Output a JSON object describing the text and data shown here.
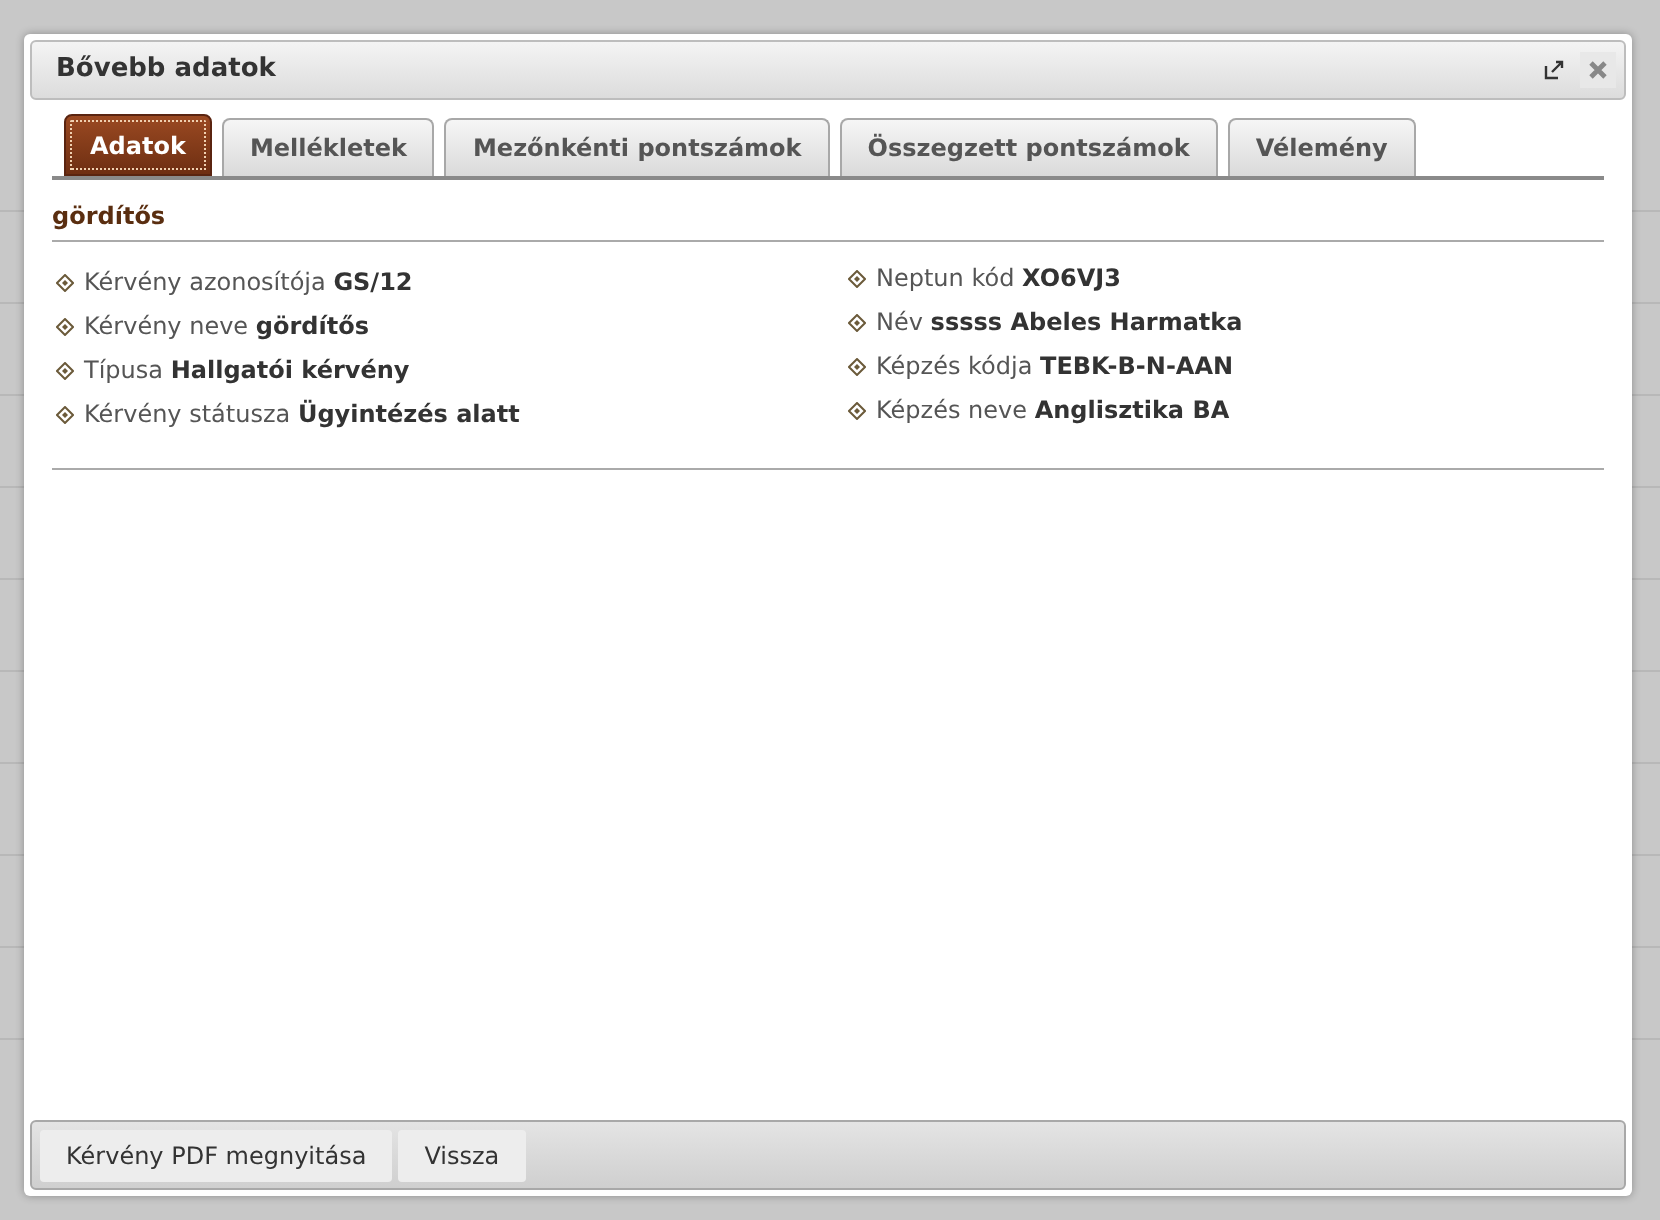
{
  "dialog": {
    "title": "Bővebb adatok"
  },
  "tabs": [
    {
      "label": "Adatok",
      "selected": true
    },
    {
      "label": "Mellékletek",
      "selected": false
    },
    {
      "label": "Mezőnkénti pontszámok",
      "selected": false
    },
    {
      "label": "Összegzett pontszámok",
      "selected": false
    },
    {
      "label": "Vélemény",
      "selected": false
    }
  ],
  "section_title": "gördítős",
  "columns": [
    [
      {
        "label": "Kérvény azonosítója",
        "value": "GS/12"
      },
      {
        "label": "Kérvény neve",
        "value": "gördítős"
      },
      {
        "label": "Típusa",
        "value": "Hallgatói kérvény"
      },
      {
        "label": "Kérvény státusza",
        "value": "Ügyintézés alatt"
      }
    ],
    [
      {
        "label": "Neptun kód",
        "value": "XO6VJ3"
      },
      {
        "label": "Név",
        "value": "sssss Abeles Harmatka"
      },
      {
        "label": "Képzés kódja",
        "value": "TEBK-B-N-AAN"
      },
      {
        "label": "Képzés neve",
        "value": "Anglisztika BA"
      }
    ]
  ],
  "buttons": [
    "Kérvény PDF megnyitása",
    "Vissza"
  ]
}
